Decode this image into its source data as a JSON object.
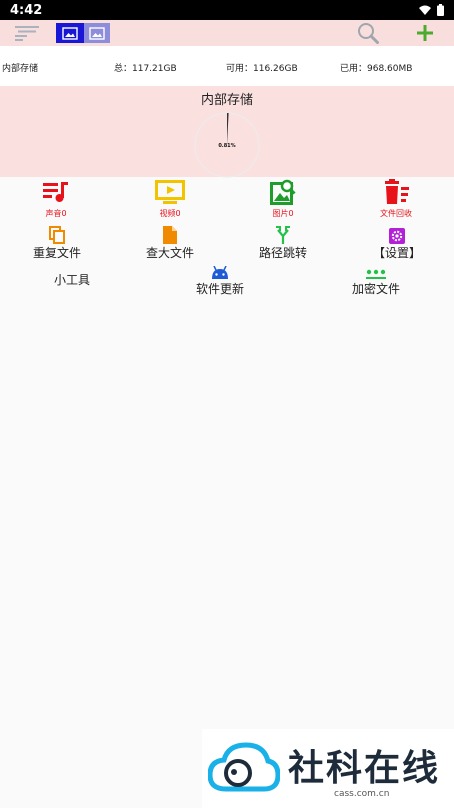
{
  "status": {
    "time": "4:42"
  },
  "storage": {
    "name": "内部存储",
    "total": "总：117.21GB",
    "available": "可用：116.26GB",
    "used": "已用：968.60MB",
    "title": "内部存储",
    "chart_label": "0.81%",
    "used_fraction": 0.0081
  },
  "categories": [
    {
      "label": "声音0",
      "color": "#e8121b",
      "icon": "music-list-icon"
    },
    {
      "label": "视频0",
      "color": "#f2c400",
      "icon": "tv-play-icon"
    },
    {
      "label": "图片0",
      "color": "#1f9d2a",
      "icon": "image-search-icon"
    },
    {
      "label": "文件回收",
      "color": "#e8121b",
      "icon": "trash-list-icon"
    }
  ],
  "tools": {
    "duplicate": {
      "label": "重复文件",
      "color": "#f08a00",
      "icon": "copy-icon"
    },
    "large": {
      "label": "查大文件",
      "color": "#f08a00",
      "icon": "file-icon"
    },
    "path": {
      "label": "路径跳转",
      "color": "#24c24a",
      "icon": "fork-icon"
    },
    "settings": {
      "label": "【设置】",
      "color": "#b321d6",
      "icon": "gear-icon"
    },
    "small": {
      "label": "小工具"
    },
    "update": {
      "label": "软件更新",
      "color": "#1d5cd6",
      "icon": "android-icon"
    },
    "encrypt": {
      "label": "加密文件",
      "color": "#24c24a",
      "icon": "dots-icon"
    }
  },
  "watermark": {
    "text": "社科在线",
    "url": "cass.com.cn"
  },
  "colors": {
    "toolbar": "#f9dede",
    "panel": "#fbe0e0",
    "accent": "#1a16d6"
  }
}
